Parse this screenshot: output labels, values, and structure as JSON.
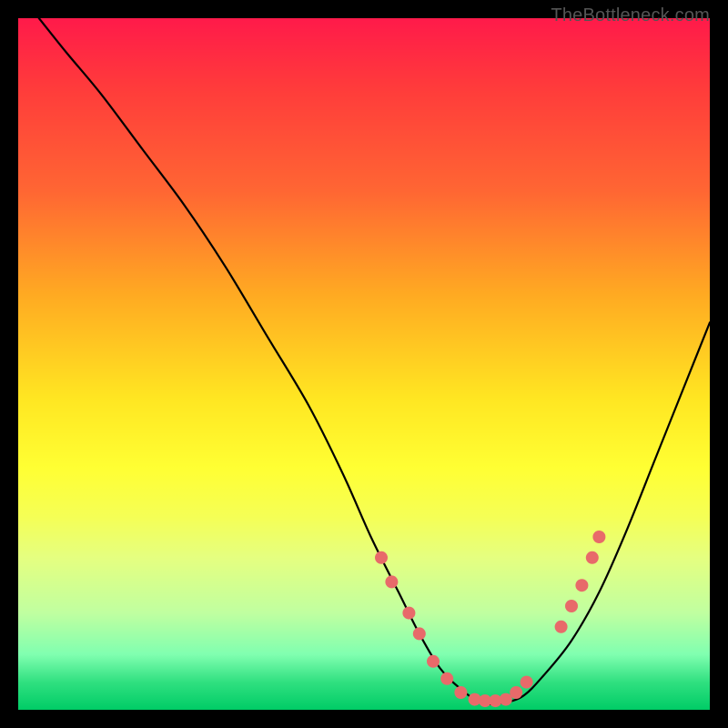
{
  "watermark": "TheBottleneck.com",
  "chart_data": {
    "type": "line",
    "title": "",
    "xlabel": "",
    "ylabel": "",
    "xlim": [
      0,
      100
    ],
    "ylim": [
      0,
      100
    ],
    "series": [
      {
        "name": "bottleneck-curve",
        "x": [
          3,
          7,
          12,
          18,
          24,
          30,
          36,
          42,
          47,
          51,
          55,
          58,
          61,
          64,
          67,
          70,
          73,
          76,
          80,
          84,
          88,
          92,
          96,
          100
        ],
        "y": [
          100,
          95,
          89,
          81,
          73,
          64,
          54,
          44,
          34,
          25,
          17,
          11,
          6,
          3,
          1,
          1,
          2,
          5,
          10,
          17,
          26,
          36,
          46,
          56
        ]
      }
    ],
    "markers": {
      "name": "highlighted-points",
      "x": [
        52.5,
        54.0,
        56.5,
        58.0,
        60.0,
        62.0,
        64.0,
        66.0,
        67.5,
        69.0,
        70.5,
        72.0,
        73.5,
        78.5,
        80.0,
        81.5,
        83.0,
        84.0
      ],
      "y": [
        22.0,
        18.5,
        14.0,
        11.0,
        7.0,
        4.5,
        2.5,
        1.5,
        1.3,
        1.3,
        1.5,
        2.5,
        4.0,
        12.0,
        15.0,
        18.0,
        22.0,
        25.0
      ]
    }
  }
}
